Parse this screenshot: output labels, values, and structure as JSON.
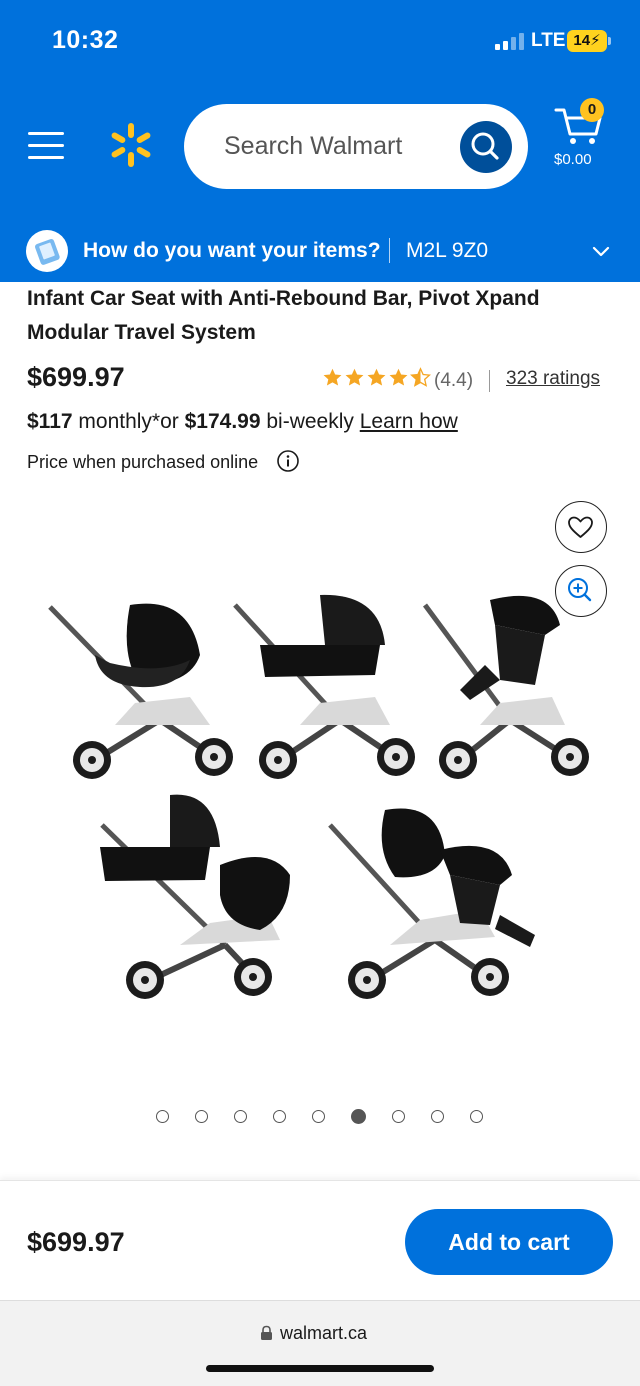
{
  "status_bar": {
    "time": "10:32",
    "network": "LTE",
    "battery": "14"
  },
  "header": {
    "search_placeholder": "Search Walmart",
    "cart_count": "0",
    "cart_total": "$0.00",
    "brand_color": "#0071dc",
    "spark_color": "#ffc220"
  },
  "delivery": {
    "question": "How do you want your items?",
    "postal_code": "M2L 9Z0"
  },
  "product": {
    "title": "Infant Car Seat with Anti-Rebound Bar, Pivot Xpand Modular Travel System",
    "price": "$699.97",
    "rating": 4.4,
    "rating_label": "(4.4)",
    "ratings_count": "323 ratings",
    "financing": {
      "monthly_amount": "$117",
      "monthly_text": " monthly*or ",
      "biweekly_amount": "$174.99",
      "biweekly_text": " bi-weekly ",
      "learn_link": "Learn how"
    },
    "price_note": "Price when purchased online"
  },
  "gallery": {
    "image_count": 9,
    "active_index": 5
  },
  "bottom_bar": {
    "price": "$699.97",
    "add_to_cart": "Add to cart"
  },
  "browser": {
    "url": "walmart.ca"
  }
}
